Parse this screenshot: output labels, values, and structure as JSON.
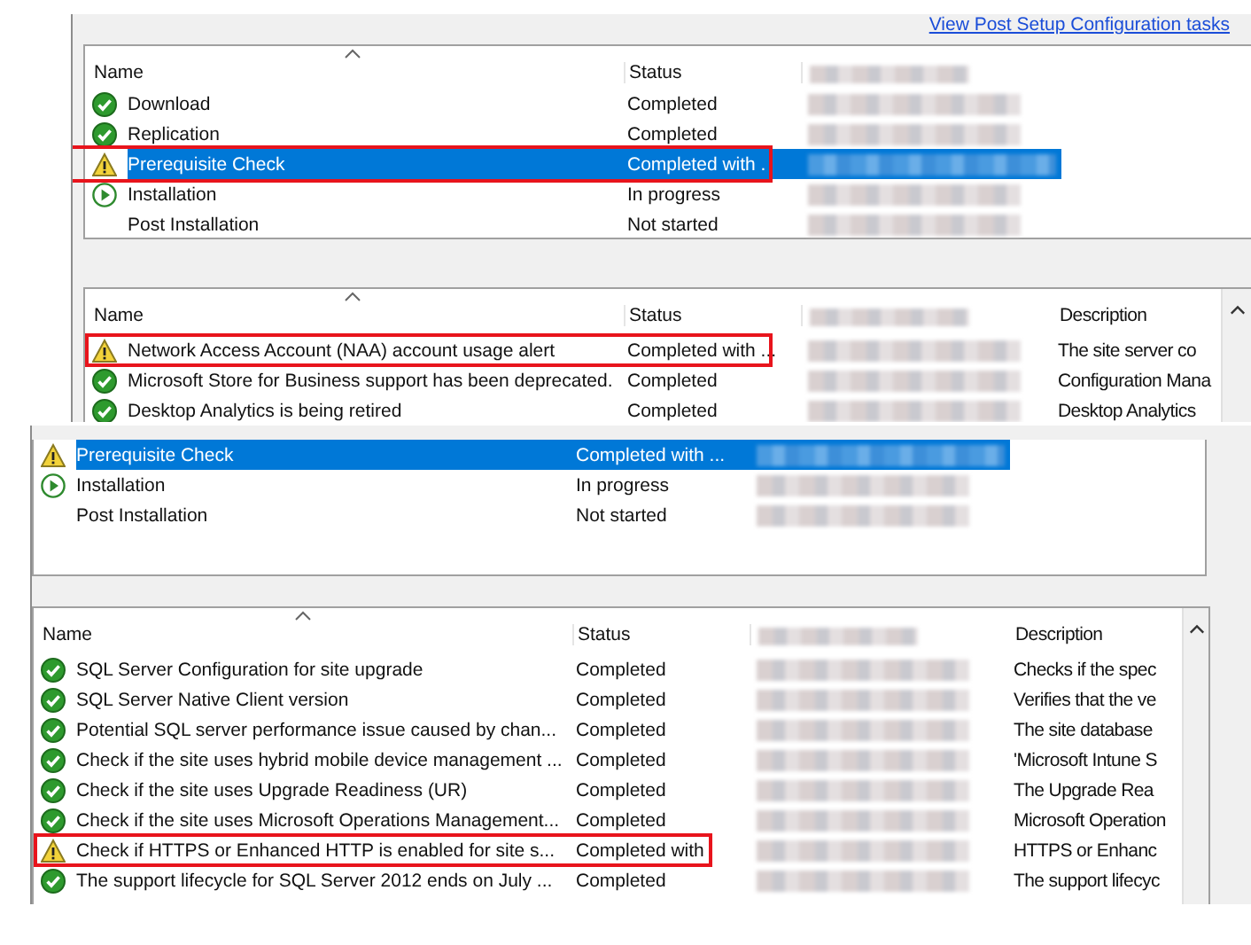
{
  "panels": [
    {
      "kind": "progress",
      "link": "View Post Setup Configuration tasks",
      "columns": [
        "Name",
        "Status"
      ],
      "rows": [
        {
          "kind": "check",
          "name": "Download",
          "status": "Completed",
          "selected": false,
          "annotated": false
        },
        {
          "kind": "check",
          "name": "Replication",
          "status": "Completed",
          "selected": false,
          "annotated": false
        },
        {
          "kind": "warning",
          "name": "Prerequisite Check",
          "status": "Completed with .",
          "selected": true,
          "annotated": true
        },
        {
          "kind": "play",
          "name": "Installation",
          "status": "In progress",
          "selected": false,
          "annotated": false
        },
        {
          "kind": "none",
          "name": "Post Installation",
          "status": "Not started",
          "selected": false,
          "annotated": false
        }
      ]
    },
    {
      "kind": "prerequisites",
      "columns": [
        "Name",
        "Status",
        "Description"
      ],
      "rows": [
        {
          "kind": "warning",
          "name": "Network Access Account (NAA) account usage alert",
          "status": "Completed with ...",
          "description": "The site server co",
          "selected": false,
          "annotated": true
        },
        {
          "kind": "check",
          "name": "Microsoft Store for Business support has been deprecated.",
          "status": "Completed",
          "description": "Configuration Mana",
          "selected": false,
          "annotated": false
        },
        {
          "kind": "check",
          "name": "Desktop Analytics is being retired",
          "status": "Completed",
          "description": "Desktop Analytics",
          "selected": false,
          "annotated": false
        }
      ]
    },
    {
      "kind": "progress",
      "rows": [
        {
          "kind": "warning",
          "name": "Prerequisite Check",
          "status": "Completed with ...",
          "selected": true,
          "annotated": false
        },
        {
          "kind": "play",
          "name": "Installation",
          "status": "In progress",
          "selected": false,
          "annotated": false
        },
        {
          "kind": "none",
          "name": "Post Installation",
          "status": "Not started",
          "selected": false,
          "annotated": false
        }
      ]
    },
    {
      "kind": "prerequisites",
      "columns": [
        "Name",
        "Status",
        "Description"
      ],
      "rows": [
        {
          "kind": "check",
          "name": "SQL Server Configuration for site upgrade",
          "status": "Completed",
          "description": "Checks if the spec",
          "selected": false,
          "annotated": false
        },
        {
          "kind": "check",
          "name": "SQL Server Native Client version",
          "status": "Completed",
          "description": "Verifies that the ve",
          "selected": false,
          "annotated": false
        },
        {
          "kind": "check",
          "name": "Potential SQL server performance issue caused by chan...",
          "status": "Completed",
          "description": "The site database",
          "selected": false,
          "annotated": false
        },
        {
          "kind": "check",
          "name": "Check if the site uses hybrid mobile device management ...",
          "status": "Completed",
          "description": "'Microsoft Intune S",
          "selected": false,
          "annotated": false
        },
        {
          "kind": "check",
          "name": "Check if the site uses Upgrade Readiness (UR)",
          "status": "Completed",
          "description": "The Upgrade Rea",
          "selected": false,
          "annotated": false
        },
        {
          "kind": "check",
          "name": "Check if the site uses Microsoft Operations Management...",
          "status": "Completed",
          "description": "Microsoft Operation",
          "selected": false,
          "annotated": false
        },
        {
          "kind": "warning",
          "name": "Check if HTTPS or Enhanced HTTP is enabled for site s...",
          "status": "Completed with",
          "description": "HTTPS or Enhanc",
          "selected": false,
          "annotated": true
        },
        {
          "kind": "check",
          "name": "The support lifecycle for SQL Server 2012 ends on July ...",
          "status": "Completed",
          "description": "The support lifecyc",
          "selected": false,
          "annotated": false
        }
      ]
    }
  ]
}
